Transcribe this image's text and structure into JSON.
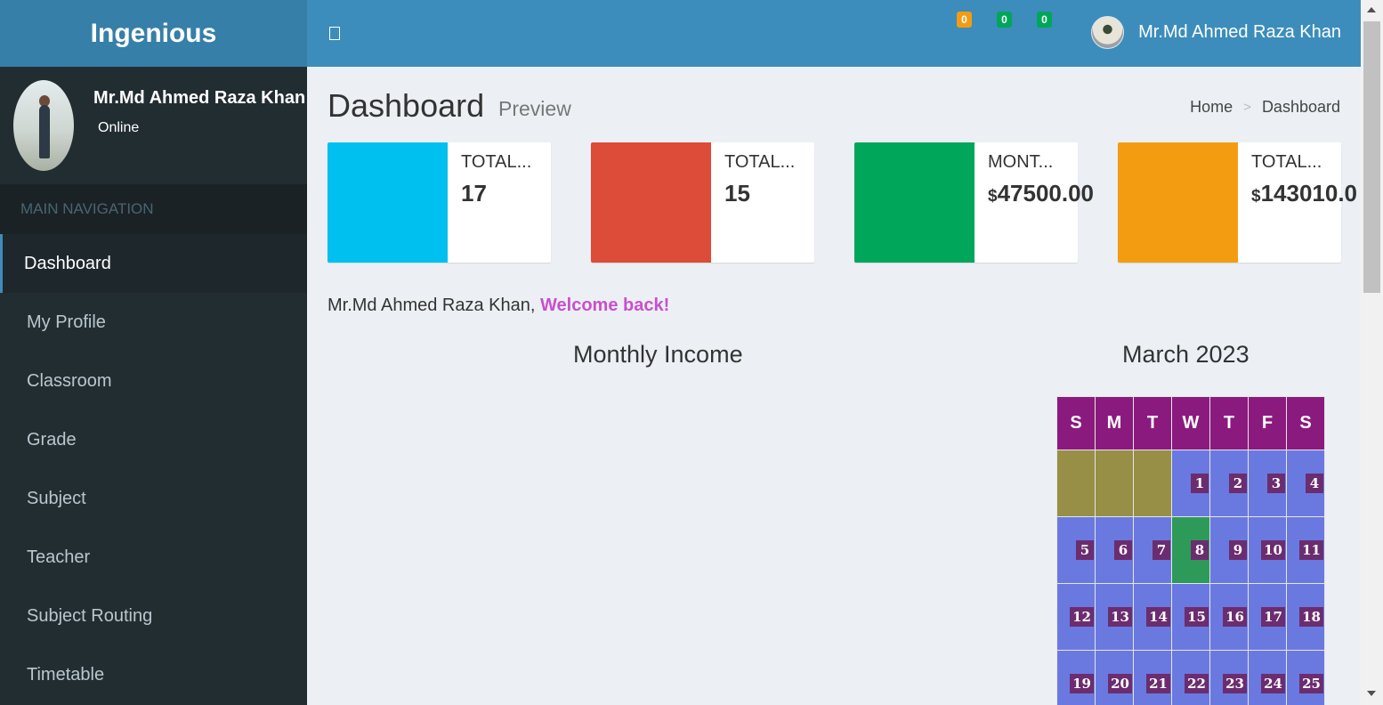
{
  "brand": "Ingenious",
  "header": {
    "badges": [
      {
        "count": "0",
        "color": "#f39c12"
      },
      {
        "count": "0",
        "color": "#00a65a"
      },
      {
        "count": "0",
        "color": "#00a65a"
      }
    ],
    "user_name": "Mr.Md Ahmed Raza Khan"
  },
  "sidebar": {
    "user_name": "Mr.Md Ahmed Raza Khan",
    "status": "Online",
    "nav_header": "MAIN NAVIGATION",
    "items": [
      {
        "label": "Dashboard",
        "active": true
      },
      {
        "label": "My Profile"
      },
      {
        "label": "Classroom"
      },
      {
        "label": "Grade"
      },
      {
        "label": "Subject"
      },
      {
        "label": "Teacher"
      },
      {
        "label": "Subject Routing"
      },
      {
        "label": "Timetable"
      }
    ]
  },
  "page": {
    "title": "Dashboard",
    "subtitle": "Preview",
    "breadcrumb": {
      "home": "Home",
      "separator": ">",
      "current": "Dashboard"
    }
  },
  "info_boxes": [
    {
      "label": "TOTAL...",
      "value": "17",
      "currency": "",
      "color": "#00c0ef"
    },
    {
      "label": "TOTAL...",
      "value": "15",
      "currency": "",
      "color": "#dd4b39"
    },
    {
      "label": "MONT...",
      "value": "47500.00",
      "currency": "$",
      "color": "#00a65a"
    },
    {
      "label": "TOTAL...",
      "value": "143010.0",
      "currency": "$",
      "color": "#f39c12"
    }
  ],
  "welcome": {
    "name": "Mr.Md Ahmed Raza Khan,",
    "message": "Welcome back!"
  },
  "chart_title": "Monthly Income",
  "calendar": {
    "title": "March 2023",
    "weekdays": [
      "S",
      "M",
      "T",
      "W",
      "T",
      "F",
      "S"
    ],
    "weeks": [
      [
        "",
        "",
        "",
        "1",
        "2",
        "3",
        "4"
      ],
      [
        "5",
        "6",
        "7",
        "8",
        "9",
        "10",
        "11"
      ],
      [
        "12",
        "13",
        "14",
        "15",
        "16",
        "17",
        "18"
      ],
      [
        "19",
        "20",
        "21",
        "22",
        "23",
        "24",
        "25"
      ]
    ],
    "today": "8"
  }
}
